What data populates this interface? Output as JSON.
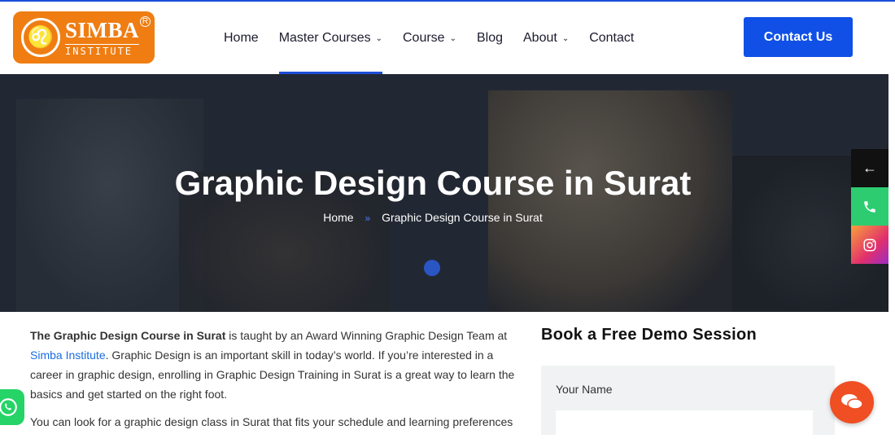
{
  "brand": {
    "name": "SIMBA",
    "sub": "INSTITUTE",
    "reg": "R",
    "accent": "#ef7d12"
  },
  "nav": {
    "items": [
      {
        "label": "Home",
        "has_menu": false
      },
      {
        "label": "Master Courses",
        "has_menu": true,
        "active": true
      },
      {
        "label": "Course",
        "has_menu": true
      },
      {
        "label": "Blog",
        "has_menu": false
      },
      {
        "label": "About",
        "has_menu": true
      },
      {
        "label": "Contact",
        "has_menu": false
      }
    ],
    "cta": "Contact Us",
    "chevron": "chevron-down-icon"
  },
  "hero": {
    "title": "Graphic Design Course in Surat",
    "breadcrumb": {
      "home": "Home",
      "separator": "»",
      "current": "Graphic Design Course in Surat"
    }
  },
  "side_bar": {
    "back": "←",
    "icons": [
      "arrow-left-icon",
      "phone-icon",
      "instagram-icon"
    ]
  },
  "content": {
    "p1_bold": "The Graphic Design Course in Surat",
    "p1_a": " is taught by an Award Winning Graphic Design Team at ",
    "p1_link": "Simba Institute",
    "p1_b": ". Graphic Design is an important skill in today’s world. If you’re interested in a career in graphic design, enrolling in Graphic Design Training in Surat is a great way to learn the basics and get started on the right foot.",
    "p2": "You can look for a graphic design class in Surat that fits your schedule and learning preferences"
  },
  "form": {
    "title": "Book a Free Demo Session",
    "name_label": "Your Name",
    "name_value": ""
  },
  "colors": {
    "primary": "#1050e6",
    "whatsapp": "#25d366",
    "chat": "#f04e23",
    "phone": "#2ecc71"
  }
}
